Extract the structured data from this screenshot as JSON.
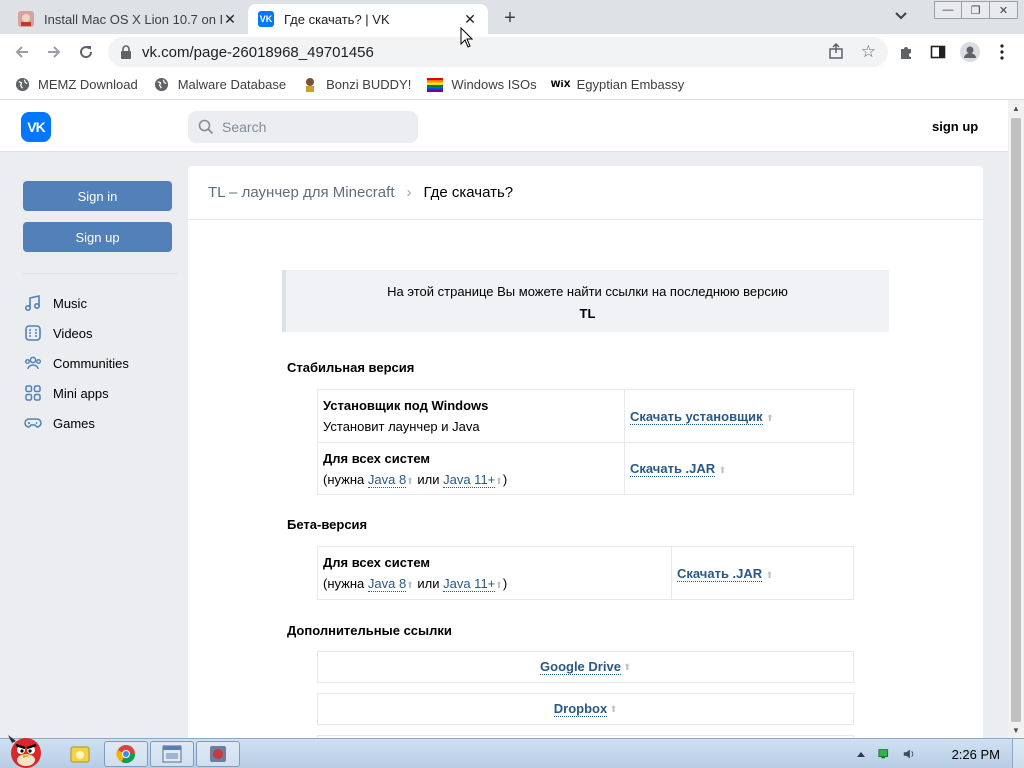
{
  "browser": {
    "tabs": [
      {
        "title": "Install Mac OS X Lion 10.7 on PC",
        "active": false
      },
      {
        "title": "Где скачать? | VK",
        "active": true
      }
    ],
    "url": "vk.com/page-26018968_49701456",
    "bookmarks": [
      {
        "label": "MEMZ Download",
        "icon": "globe-icon"
      },
      {
        "label": "Malware Database",
        "icon": "globe-icon"
      },
      {
        "label": "Bonzi BUDDY!",
        "icon": "bonzi-icon"
      },
      {
        "label": "Windows ISOs",
        "icon": "rainbow-flag-icon"
      },
      {
        "label": "Egyptian Embassy",
        "icon": "wix-icon"
      }
    ],
    "accent": "#1a73e8"
  },
  "vk": {
    "logo": "VK",
    "search_placeholder": "Search",
    "signup_link": "sign up",
    "sign_in": "Sign in",
    "sign_up": "Sign up",
    "menu": [
      {
        "label": "Music",
        "icon": "music-icon"
      },
      {
        "label": "Videos",
        "icon": "videos-icon"
      },
      {
        "label": "Communities",
        "icon": "communities-icon"
      },
      {
        "label": "Mini apps",
        "icon": "mini-apps-icon"
      },
      {
        "label": "Games",
        "icon": "gamepad-icon"
      }
    ],
    "breadcrumb": {
      "parent": "TL – лаунчер для Minecraft",
      "sep": "›",
      "current": "Где скачать?"
    },
    "notice": {
      "line1": "На этой странице Вы можете найти ссылки на последнюю версию",
      "line2": "TL"
    },
    "stable": {
      "heading": "Стабильная версия",
      "rows": [
        {
          "name": "Установщик под Windows",
          "desc": "Установит лаунчер и Java",
          "link": "Скачать установщик"
        },
        {
          "name": "Для всех систем",
          "desc_prefix": "(нужна",
          "java8": "Java 8",
          "or": "или",
          "java11": "Java 11+",
          "desc_suffix": ")",
          "link": "Скачать .JAR"
        }
      ]
    },
    "beta": {
      "heading": "Бета-версия",
      "rows": [
        {
          "name": "Для всех систем",
          "desc_prefix": "(нужна",
          "java8": "Java 8",
          "or": "или",
          "java11": "Java 11+",
          "desc_suffix": ")",
          "link": "Скачать .JAR"
        }
      ]
    },
    "extra": {
      "heading": "Дополнительные ссылки",
      "links": [
        "Google Drive",
        "Dropbox"
      ]
    },
    "link_color": "#2a5885",
    "button_color": "#5181b8"
  },
  "taskbar": {
    "clock": "2:26 PM"
  }
}
